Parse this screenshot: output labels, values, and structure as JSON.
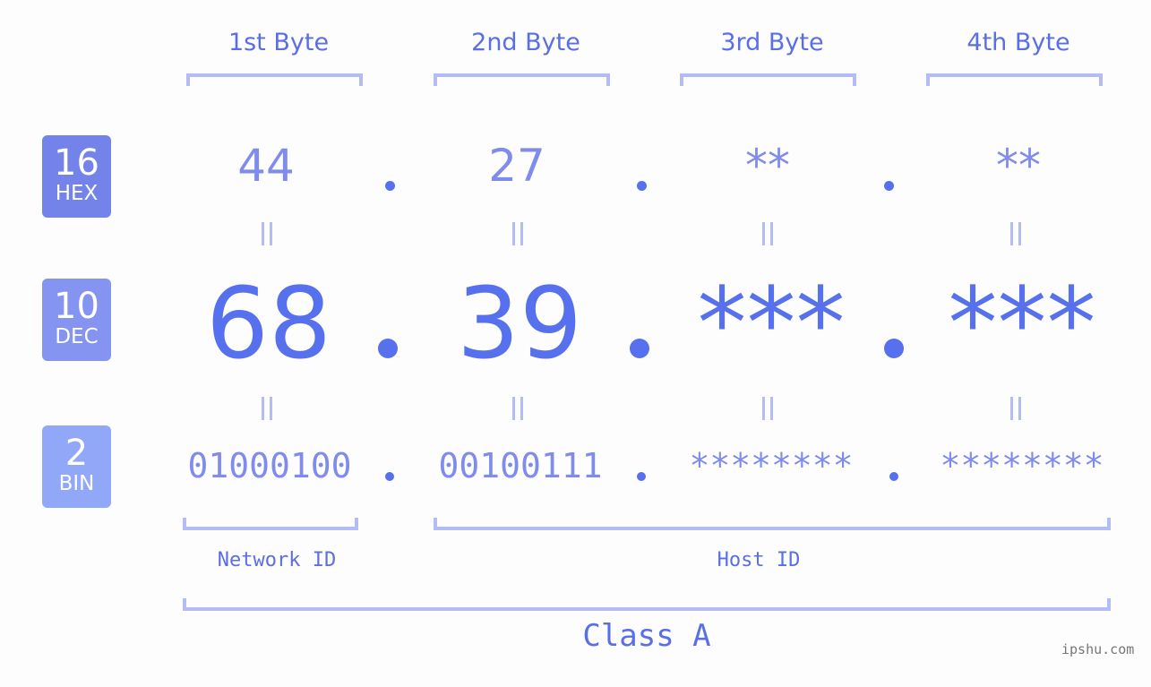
{
  "byte_headers": [
    "1st Byte",
    "2nd Byte",
    "3rd Byte",
    "4th Byte"
  ],
  "badges": [
    {
      "base": "16",
      "label": "HEX",
      "color": "#7383ea"
    },
    {
      "base": "10",
      "label": "DEC",
      "color": "#8594f1"
    },
    {
      "base": "2",
      "label": "BIN",
      "color": "#91a8f8"
    }
  ],
  "hex": [
    "44",
    "27",
    "**",
    "**"
  ],
  "dec": [
    "68",
    "39",
    "***",
    "***"
  ],
  "bin": [
    "01000100",
    "00100111",
    "********",
    "********"
  ],
  "separator": ".",
  "network_id_label": "Network ID",
  "host_id_label": "Host ID",
  "class_label": "Class A",
  "watermark": "ipshu.com",
  "colors": {
    "primary": "#5670ee",
    "light": "#7f8ced",
    "bracket": "#b3bcf5"
  }
}
